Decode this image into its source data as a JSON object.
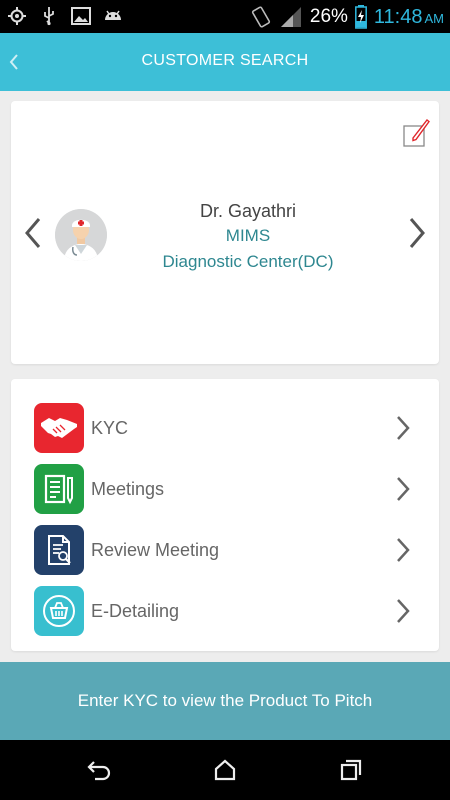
{
  "status_bar": {
    "battery_percent": "26%",
    "time": "11:48",
    "ampm": "AM",
    "left_icons": [
      "gps-icon",
      "usb-icon",
      "image-icon",
      "android-icon"
    ],
    "right_icons": [
      "rotate-icon",
      "signal-icon",
      "battery-charging-icon"
    ]
  },
  "header": {
    "title": "CUSTOMER SEARCH",
    "back_icon": "back-chevron-icon",
    "color": "#3dbfd7"
  },
  "profile": {
    "name": "Dr. Gayathri",
    "org_line1": "MIMS",
    "org_line2": "Diagnostic Center(DC)",
    "avatar_icon": "doctor-avatar-icon",
    "edit_icon": "edit-icon",
    "prev_icon": "chevron-left-icon",
    "next_icon": "chevron-right-icon",
    "accent": "#2e8790"
  },
  "menu": {
    "items": [
      {
        "label": "KYC",
        "icon": "handshake-icon",
        "color": "#e8262f"
      },
      {
        "label": "Meetings",
        "icon": "notepad-icon",
        "color": "#21a045"
      },
      {
        "label": "Review Meeting",
        "icon": "document-review-icon",
        "color": "#23416a"
      },
      {
        "label": "E-Detailing",
        "icon": "basket-icon",
        "color": "#38bfcf"
      }
    ]
  },
  "banner": {
    "text": "Enter KYC to view the Product To Pitch",
    "color": "#5aa8b6"
  },
  "system_nav": {
    "icons": [
      "back-icon",
      "home-icon",
      "recents-icon"
    ]
  }
}
